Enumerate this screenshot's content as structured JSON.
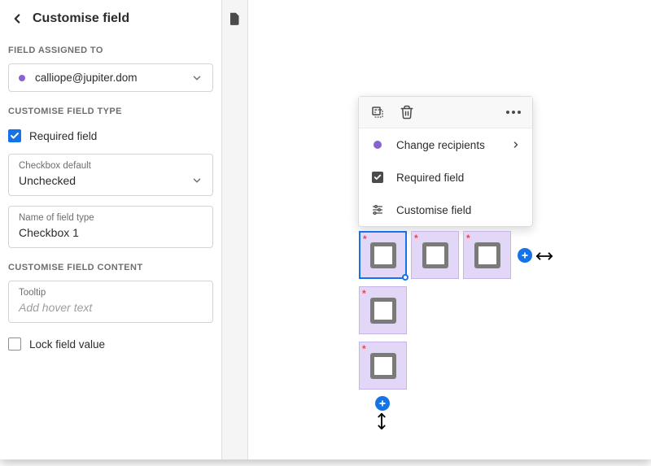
{
  "sidebar": {
    "title": "Customise field",
    "sections": {
      "assigned_to_label": "FIELD ASSIGNED TO",
      "assigned_to_value": "calliope@jupiter.dom",
      "type_label": "CUSTOMISE FIELD TYPE",
      "required_label": "Required field",
      "required_checked": true,
      "default_label": "Checkbox default",
      "default_value": "Unchecked",
      "name_label": "Name of field type",
      "name_value": "Checkbox 1",
      "content_label": "CUSTOMISE FIELD CONTENT",
      "tooltip_label": "Tooltip",
      "tooltip_placeholder": "Add hover text",
      "lock_label": "Lock field value",
      "lock_checked": false
    }
  },
  "context_menu": {
    "change_recipients": "Change recipients",
    "required_field": "Required field",
    "customise_field": "Customise field"
  },
  "canvas": {
    "fields": [
      {
        "required": true,
        "selected": true
      },
      {
        "required": true,
        "selected": false
      },
      {
        "required": true,
        "selected": false
      },
      {
        "required": true,
        "selected": false
      },
      {
        "required": true,
        "selected": false
      }
    ]
  },
  "colors": {
    "accent": "#1473e6",
    "purple": "#8a63d2",
    "field_bg": "#e3d7f7"
  }
}
